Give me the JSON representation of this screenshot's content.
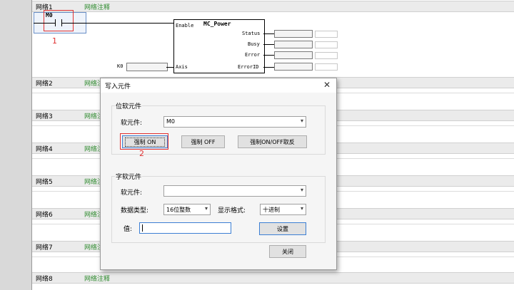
{
  "networks": [
    {
      "name": "网络1",
      "comment": "网络注释"
    },
    {
      "name": "网络2",
      "comment": "网络注"
    },
    {
      "name": "网络3",
      "comment": "网络注"
    },
    {
      "name": "网络4",
      "comment": "网络注"
    },
    {
      "name": "网络5",
      "comment": "网络注"
    },
    {
      "name": "网络6",
      "comment": "网络注"
    },
    {
      "name": "网络7",
      "comment": "网络注"
    },
    {
      "name": "网络8",
      "comment": "网络注释"
    }
  ],
  "ladder": {
    "contact": "M0",
    "block_title": "MC_Power",
    "pins": {
      "enable": "Enable",
      "axis": "Axis",
      "status": "Status",
      "busy": "Busy",
      "error": "Error",
      "error_id": "ErrorID"
    },
    "axis_input": "K0"
  },
  "annotations": {
    "step1": "1",
    "step2": "2"
  },
  "dialog": {
    "title": "写入元件",
    "close": "✕",
    "bit_group": {
      "title": "位软元件",
      "device_label": "软元件:",
      "device_value": "M0",
      "force_on": "强制 ON",
      "force_off": "强制 OFF",
      "force_invert": "强制ON/OFF取反"
    },
    "word_group": {
      "title": "字软元件",
      "device_label": "软元件:",
      "device_value": "",
      "data_type_label": "数据类型:",
      "data_type_value": "16位整数",
      "format_label": "显示格式:",
      "format_value": "十进制",
      "value_label": "值:",
      "value": "",
      "set_button": "设置"
    },
    "close_button": "关闭"
  },
  "colors": {
    "comment": "#2e8b2e",
    "annotation": "#e03030",
    "focus": "#3c7fd4"
  }
}
